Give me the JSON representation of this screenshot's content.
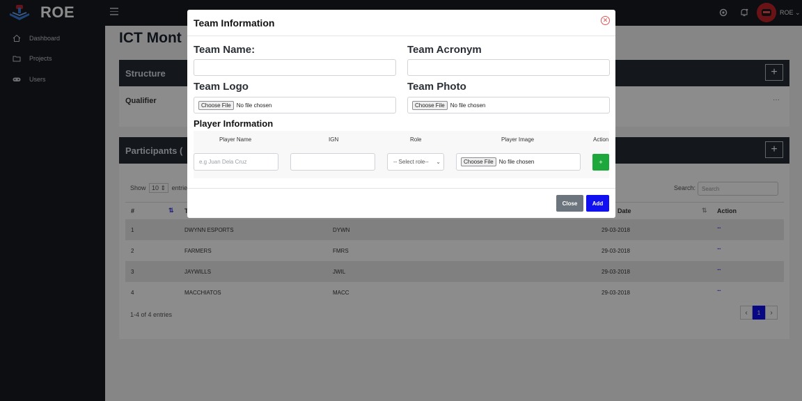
{
  "brand": {
    "name": "ROE"
  },
  "sidebar": {
    "items": [
      {
        "label": "Dashboard",
        "icon": "home-icon"
      },
      {
        "label": "Projects",
        "icon": "folder-icon"
      },
      {
        "label": "Users",
        "icon": "gamepad-icon"
      }
    ]
  },
  "topbar": {
    "user_name": "ROE"
  },
  "page": {
    "title": "ICT Mont",
    "structure_title": "Structure",
    "qualifier_label": "Qualifier",
    "participants_title": "Participants (",
    "show_label": "Show",
    "entries_value": "10",
    "entries_label": "entrie",
    "search_label": "Search:",
    "search_placeholder": "Search",
    "col_number": "#",
    "col_t": "T",
    "col_date": "Date",
    "col_action": "Action",
    "rows": [
      {
        "num": "1",
        "name": "DWYNN ESPORTS",
        "acronym": "DYWN",
        "date": "29-03-2018"
      },
      {
        "num": "2",
        "name": "FARMERS",
        "acronym": "FMRS",
        "date": "29-03-2018"
      },
      {
        "num": "3",
        "name": "JAYWILLS",
        "acronym": "JWIL",
        "date": "29-03-2018"
      },
      {
        "num": "4",
        "name": "MACCHIATOS",
        "acronym": "MACC",
        "date": "29-03-2018"
      }
    ],
    "footer_info": "1-4 of 4 entries",
    "current_page": "1",
    "more_dots": "···"
  },
  "modal": {
    "title": "Team Information",
    "team_name_label": "Team Name:",
    "team_acronym_label": "Team Acronym",
    "team_logo_label": "Team Logo",
    "team_photo_label": "Team Photo",
    "choose_file": "Choose File",
    "no_file": "No file chosen",
    "player_info_title": "Player Information",
    "col_player_name": "Player Name",
    "col_ign": "IGN",
    "col_role": "Role",
    "col_player_image": "Player Image",
    "col_action": "Action",
    "player_name_placeholder": "e.g Juan Dela Cruz",
    "role_placeholder": "-- Select role--",
    "add_row_label": "+",
    "close_label": "Close",
    "add_label": "Add"
  },
  "colors": {
    "sidebar_bg": "#161a21",
    "accent_blue": "#1010f0",
    "green": "#1ea83c"
  }
}
